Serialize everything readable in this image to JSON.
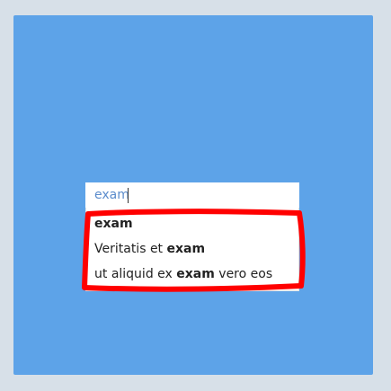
{
  "search": {
    "value": "exam",
    "placeholder": ""
  },
  "suggestions": [
    {
      "before": "",
      "match": "exam",
      "after": ""
    },
    {
      "before": "Veritatis et ",
      "match": "exam",
      "after": ""
    },
    {
      "before": "ut aliquid ex ",
      "match": "exam",
      "after": " vero eos"
    }
  ],
  "colors": {
    "page_background": "#d7e0e8",
    "panel_background": "#5da3e8",
    "input_text": "#5b8ccc",
    "annotation_outline": "#ff0000"
  }
}
